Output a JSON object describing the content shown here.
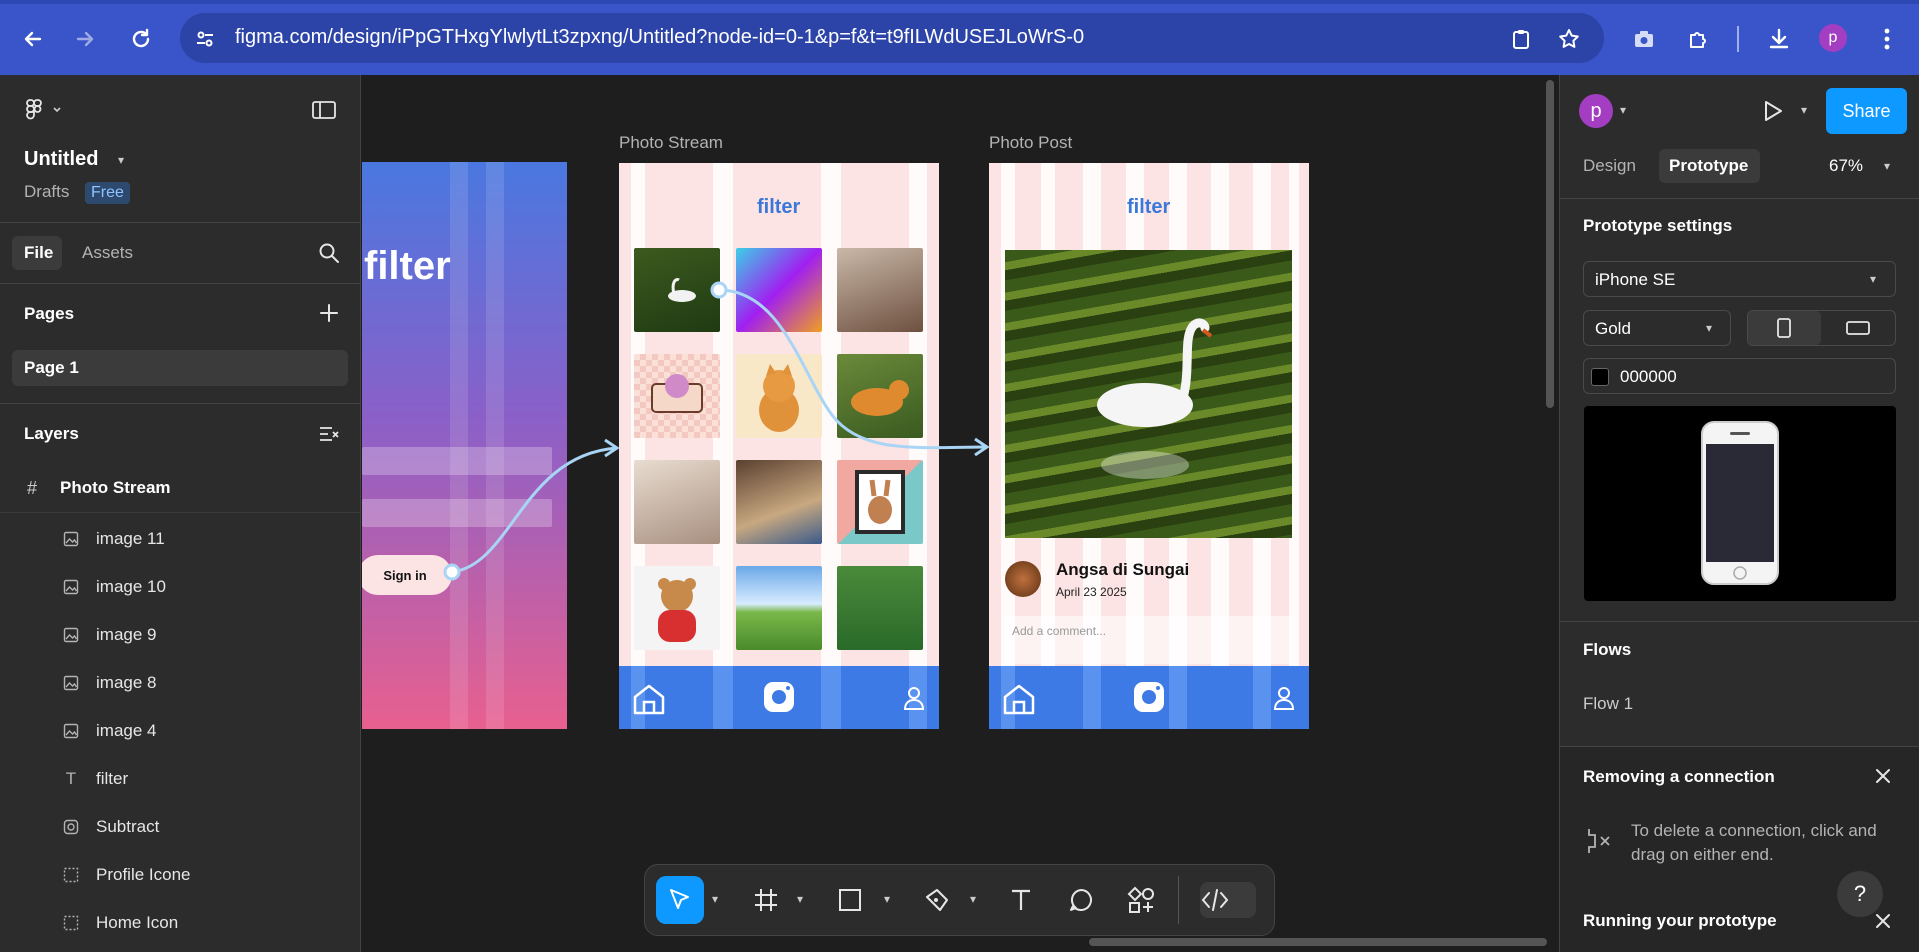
{
  "browser": {
    "url": "figma.com/design/iPpGTHxgYlwlytLt3zpxng/Untitled?node-id=0-1&p=f&t=t9fILWdUSEJLoWrS-0",
    "profile_initial": "p"
  },
  "left_panel": {
    "file_title": "Untitled",
    "location": "Drafts",
    "plan_badge": "Free",
    "tabs": {
      "file": "File",
      "assets": "Assets"
    },
    "pages_heading": "Pages",
    "pages": [
      "Page 1"
    ],
    "layers_heading": "Layers",
    "root_layer": "Photo Stream",
    "layers": [
      {
        "label": "image 11",
        "icon": "image-icon"
      },
      {
        "label": "image 10",
        "icon": "image-icon"
      },
      {
        "label": "image 9",
        "icon": "image-icon"
      },
      {
        "label": "image 8",
        "icon": "image-icon"
      },
      {
        "label": "image 4",
        "icon": "image-icon"
      },
      {
        "label": "filter",
        "icon": "text-icon"
      },
      {
        "label": "Subtract",
        "icon": "boolean-icon"
      },
      {
        "label": "Profile Icone",
        "icon": "group-icon"
      },
      {
        "label": "Home Icon",
        "icon": "group-icon"
      }
    ]
  },
  "canvas": {
    "login_frame": {
      "title": "filter",
      "button": "Sign in"
    },
    "photo_stream": {
      "label": "Photo Stream",
      "title": "filter"
    },
    "photo_post": {
      "label": "Photo Post",
      "title": "filter",
      "author": "Angsa di Sungai",
      "date": "April 23 2025",
      "comment_placeholder": "Add a comment..."
    }
  },
  "right_panel": {
    "avatar_initial": "p",
    "share_label": "Share",
    "tabs": {
      "design": "Design",
      "prototype": "Prototype"
    },
    "zoom": "67%",
    "prototype_settings_heading": "Prototype settings",
    "device": "iPhone SE",
    "device_model": "Gold",
    "background_hex": "000000",
    "flows_heading": "Flows",
    "flows": [
      "Flow 1"
    ],
    "tip_heading": "Removing a connection",
    "tip_text_line1": "To delete a connection, click and",
    "tip_text_line2": "drag on either end.",
    "running_heading": "Running your prototype",
    "help_label": "?"
  },
  "colors": {
    "accent": "#0d99ff",
    "browser_bar": "#3a55c9",
    "frame_pink": "#fde4e4",
    "nav_blue": "#3d7ae6"
  }
}
